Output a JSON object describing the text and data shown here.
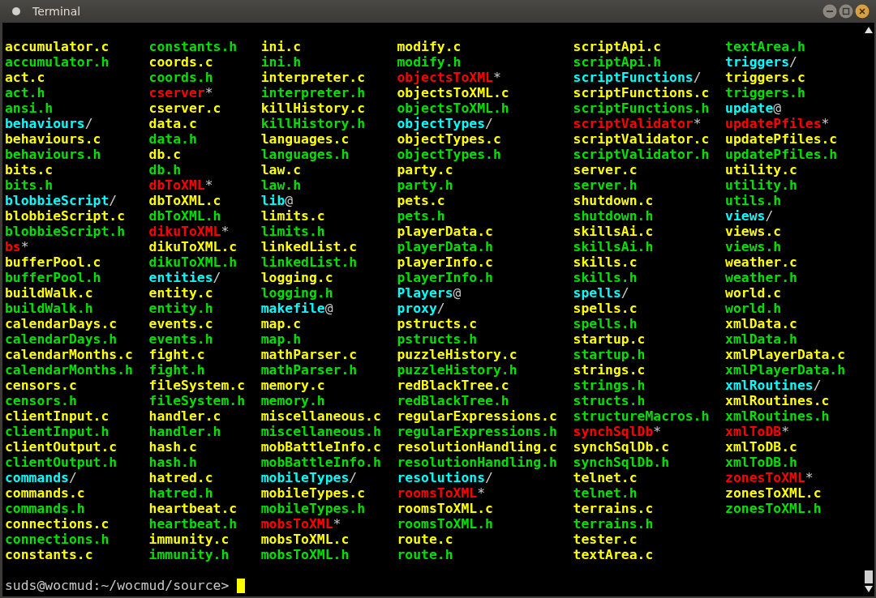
{
  "window": {
    "title": "Terminal"
  },
  "listing": {
    "columns": [
      [
        {
          "name": "accumulator.c",
          "color": "#ffff00"
        },
        {
          "name": "accumulator.h",
          "color": "#00e000"
        },
        {
          "name": "act.c",
          "color": "#ffff00"
        },
        {
          "name": "act.h",
          "color": "#00e000"
        },
        {
          "name": "ansi.h",
          "color": "#00e000"
        },
        {
          "name": "behaviours",
          "suffix": "/",
          "color": "#00ffff"
        },
        {
          "name": "behaviours.c",
          "color": "#ffff00"
        },
        {
          "name": "behaviours.h",
          "color": "#00e000"
        },
        {
          "name": "bits.c",
          "color": "#ffff00"
        },
        {
          "name": "bits.h",
          "color": "#00e000"
        },
        {
          "name": "blobbieScript",
          "suffix": "/",
          "color": "#00ffff"
        },
        {
          "name": "blobbieScript.c",
          "color": "#ffff00"
        },
        {
          "name": "blobbieScript.h",
          "color": "#00e000"
        },
        {
          "name": "bs",
          "suffix": "*",
          "color": "#ff0000"
        },
        {
          "name": "bufferPool.c",
          "color": "#ffff00"
        },
        {
          "name": "bufferPool.h",
          "color": "#00e000"
        },
        {
          "name": "buildWalk.c",
          "color": "#ffff00"
        },
        {
          "name": "buildWalk.h",
          "color": "#00e000"
        },
        {
          "name": "calendarDays.c",
          "color": "#ffff00"
        },
        {
          "name": "calendarDays.h",
          "color": "#00e000"
        },
        {
          "name": "calendarMonths.c",
          "color": "#ffff00"
        },
        {
          "name": "calendarMonths.h",
          "color": "#00e000"
        },
        {
          "name": "censors.c",
          "color": "#ffff00"
        },
        {
          "name": "censors.h",
          "color": "#00e000"
        },
        {
          "name": "clientInput.c",
          "color": "#ffff00"
        },
        {
          "name": "clientInput.h",
          "color": "#00e000"
        },
        {
          "name": "clientOutput.c",
          "color": "#ffff00"
        },
        {
          "name": "clientOutput.h",
          "color": "#00e000"
        },
        {
          "name": "commands",
          "suffix": "/",
          "color": "#00ffff"
        },
        {
          "name": "commands.c",
          "color": "#ffff00"
        },
        {
          "name": "commands.h",
          "color": "#00e000"
        },
        {
          "name": "connections.c",
          "color": "#ffff00"
        },
        {
          "name": "connections.h",
          "color": "#00e000"
        },
        {
          "name": "constants.c",
          "color": "#ffff00"
        }
      ],
      [
        {
          "name": "constants.h",
          "color": "#00e000"
        },
        {
          "name": "coords.c",
          "color": "#ffff00"
        },
        {
          "name": "coords.h",
          "color": "#00e000"
        },
        {
          "name": "cserver",
          "suffix": "*",
          "color": "#ff0000"
        },
        {
          "name": "cserver.c",
          "color": "#ffff00"
        },
        {
          "name": "data.c",
          "color": "#ffff00"
        },
        {
          "name": "data.h",
          "color": "#00e000"
        },
        {
          "name": "db.c",
          "color": "#ffff00"
        },
        {
          "name": "db.h",
          "color": "#00e000"
        },
        {
          "name": "dbToXML",
          "suffix": "*",
          "color": "#ff0000"
        },
        {
          "name": "dbToXML.c",
          "color": "#ffff00"
        },
        {
          "name": "dbToXML.h",
          "color": "#00e000"
        },
        {
          "name": "dikuToXML",
          "suffix": "*",
          "color": "#ff0000"
        },
        {
          "name": "dikuToXML.c",
          "color": "#ffff00"
        },
        {
          "name": "dikuToXML.h",
          "color": "#00e000"
        },
        {
          "name": "entities",
          "suffix": "/",
          "color": "#00ffff"
        },
        {
          "name": "entity.c",
          "color": "#ffff00"
        },
        {
          "name": "entity.h",
          "color": "#00e000"
        },
        {
          "name": "events.c",
          "color": "#ffff00"
        },
        {
          "name": "events.h",
          "color": "#00e000"
        },
        {
          "name": "fight.c",
          "color": "#ffff00"
        },
        {
          "name": "fight.h",
          "color": "#00e000"
        },
        {
          "name": "fileSystem.c",
          "color": "#ffff00"
        },
        {
          "name": "fileSystem.h",
          "color": "#00e000"
        },
        {
          "name": "handler.c",
          "color": "#ffff00"
        },
        {
          "name": "handler.h",
          "color": "#00e000"
        },
        {
          "name": "hash.c",
          "color": "#ffff00"
        },
        {
          "name": "hash.h",
          "color": "#00e000"
        },
        {
          "name": "hatred.c",
          "color": "#ffff00"
        },
        {
          "name": "hatred.h",
          "color": "#00e000"
        },
        {
          "name": "heartbeat.c",
          "color": "#ffff00"
        },
        {
          "name": "heartbeat.h",
          "color": "#00e000"
        },
        {
          "name": "immunity.c",
          "color": "#ffff00"
        },
        {
          "name": "immunity.h",
          "color": "#00e000"
        }
      ],
      [
        {
          "name": "ini.c",
          "color": "#ffff00"
        },
        {
          "name": "ini.h",
          "color": "#00e000"
        },
        {
          "name": "interpreter.c",
          "color": "#ffff00"
        },
        {
          "name": "interpreter.h",
          "color": "#00e000"
        },
        {
          "name": "killHistory.c",
          "color": "#ffff00"
        },
        {
          "name": "killHistory.h",
          "color": "#00e000"
        },
        {
          "name": "languages.c",
          "color": "#ffff00"
        },
        {
          "name": "languages.h",
          "color": "#00e000"
        },
        {
          "name": "law.c",
          "color": "#ffff00"
        },
        {
          "name": "law.h",
          "color": "#00e000"
        },
        {
          "name": "lib",
          "suffix": "@",
          "color": "#00ffff"
        },
        {
          "name": "limits.c",
          "color": "#ffff00"
        },
        {
          "name": "limits.h",
          "color": "#00e000"
        },
        {
          "name": "linkedList.c",
          "color": "#ffff00"
        },
        {
          "name": "linkedList.h",
          "color": "#00e000"
        },
        {
          "name": "logging.c",
          "color": "#ffff00"
        },
        {
          "name": "logging.h",
          "color": "#00e000"
        },
        {
          "name": "makefile",
          "suffix": "@",
          "color": "#00ffff"
        },
        {
          "name": "map.c",
          "color": "#ffff00"
        },
        {
          "name": "map.h",
          "color": "#00e000"
        },
        {
          "name": "mathParser.c",
          "color": "#ffff00"
        },
        {
          "name": "mathParser.h",
          "color": "#00e000"
        },
        {
          "name": "memory.c",
          "color": "#ffff00"
        },
        {
          "name": "memory.h",
          "color": "#00e000"
        },
        {
          "name": "miscellaneous.c",
          "color": "#ffff00"
        },
        {
          "name": "miscellaneous.h",
          "color": "#00e000"
        },
        {
          "name": "mobBattleInfo.c",
          "color": "#ffff00"
        },
        {
          "name": "mobBattleInfo.h",
          "color": "#00e000"
        },
        {
          "name": "mobileTypes",
          "suffix": "/",
          "color": "#00ffff"
        },
        {
          "name": "mobileTypes.c",
          "color": "#ffff00"
        },
        {
          "name": "mobileTypes.h",
          "color": "#00e000"
        },
        {
          "name": "mobsToXML",
          "suffix": "*",
          "color": "#ff0000"
        },
        {
          "name": "mobsToXML.c",
          "color": "#ffff00"
        },
        {
          "name": "mobsToXML.h",
          "color": "#00e000"
        }
      ],
      [
        {
          "name": "modify.c",
          "color": "#ffff00"
        },
        {
          "name": "modify.h",
          "color": "#00e000"
        },
        {
          "name": "objectsToXML",
          "suffix": "*",
          "color": "#ff0000"
        },
        {
          "name": "objectsToXML.c",
          "color": "#ffff00"
        },
        {
          "name": "objectsToXML.h",
          "color": "#00e000"
        },
        {
          "name": "objectTypes",
          "suffix": "/",
          "color": "#00ffff"
        },
        {
          "name": "objectTypes.c",
          "color": "#ffff00"
        },
        {
          "name": "objectTypes.h",
          "color": "#00e000"
        },
        {
          "name": "party.c",
          "color": "#ffff00"
        },
        {
          "name": "party.h",
          "color": "#00e000"
        },
        {
          "name": "pets.c",
          "color": "#ffff00"
        },
        {
          "name": "pets.h",
          "color": "#00e000"
        },
        {
          "name": "playerData.c",
          "color": "#ffff00"
        },
        {
          "name": "playerData.h",
          "color": "#00e000"
        },
        {
          "name": "playerInfo.c",
          "color": "#ffff00"
        },
        {
          "name": "playerInfo.h",
          "color": "#00e000"
        },
        {
          "name": "Players",
          "suffix": "@",
          "color": "#00ffff"
        },
        {
          "name": "proxy",
          "suffix": "/",
          "color": "#00ffff"
        },
        {
          "name": "pstructs.c",
          "color": "#ffff00"
        },
        {
          "name": "pstructs.h",
          "color": "#00e000"
        },
        {
          "name": "puzzleHistory.c",
          "color": "#ffff00"
        },
        {
          "name": "puzzleHistory.h",
          "color": "#00e000"
        },
        {
          "name": "redBlackTree.c",
          "color": "#ffff00"
        },
        {
          "name": "redBlackTree.h",
          "color": "#00e000"
        },
        {
          "name": "regularExpressions.c",
          "color": "#ffff00"
        },
        {
          "name": "regularExpressions.h",
          "color": "#00e000"
        },
        {
          "name": "resolutionHandling.c",
          "color": "#ffff00"
        },
        {
          "name": "resolutionHandling.h",
          "color": "#00e000"
        },
        {
          "name": "resolutions",
          "suffix": "/",
          "color": "#00ffff"
        },
        {
          "name": "roomsToXML",
          "suffix": "*",
          "color": "#ff0000"
        },
        {
          "name": "roomsToXML.c",
          "color": "#ffff00"
        },
        {
          "name": "roomsToXML.h",
          "color": "#00e000"
        },
        {
          "name": "route.c",
          "color": "#ffff00"
        },
        {
          "name": "route.h",
          "color": "#00e000"
        }
      ],
      [
        {
          "name": "scriptApi.c",
          "color": "#ffff00"
        },
        {
          "name": "scriptApi.h",
          "color": "#00e000"
        },
        {
          "name": "scriptFunctions",
          "suffix": "/",
          "color": "#00ffff"
        },
        {
          "name": "scriptFunctions.c",
          "color": "#ffff00"
        },
        {
          "name": "scriptFunctions.h",
          "color": "#00e000"
        },
        {
          "name": "scriptValidator",
          "suffix": "*",
          "color": "#ff0000"
        },
        {
          "name": "scriptValidator.c",
          "color": "#ffff00"
        },
        {
          "name": "scriptValidator.h",
          "color": "#00e000"
        },
        {
          "name": "server.c",
          "color": "#ffff00"
        },
        {
          "name": "server.h",
          "color": "#00e000"
        },
        {
          "name": "shutdown.c",
          "color": "#ffff00"
        },
        {
          "name": "shutdown.h",
          "color": "#00e000"
        },
        {
          "name": "skillsAi.c",
          "color": "#ffff00"
        },
        {
          "name": "skillsAi.h",
          "color": "#00e000"
        },
        {
          "name": "skills.c",
          "color": "#ffff00"
        },
        {
          "name": "skills.h",
          "color": "#00e000"
        },
        {
          "name": "spells",
          "suffix": "/",
          "color": "#00ffff"
        },
        {
          "name": "spells.c",
          "color": "#ffff00"
        },
        {
          "name": "spells.h",
          "color": "#00e000"
        },
        {
          "name": "startup.c",
          "color": "#ffff00"
        },
        {
          "name": "startup.h",
          "color": "#00e000"
        },
        {
          "name": "strings.c",
          "color": "#ffff00"
        },
        {
          "name": "strings.h",
          "color": "#00e000"
        },
        {
          "name": "structs.h",
          "color": "#00e000"
        },
        {
          "name": "structureMacros.h",
          "color": "#00e000"
        },
        {
          "name": "synchSqlDb",
          "suffix": "*",
          "color": "#ff0000"
        },
        {
          "name": "synchSqlDb.c",
          "color": "#ffff00"
        },
        {
          "name": "synchSqlDb.h",
          "color": "#00e000"
        },
        {
          "name": "telnet.c",
          "color": "#ffff00"
        },
        {
          "name": "telnet.h",
          "color": "#00e000"
        },
        {
          "name": "terrains.c",
          "color": "#ffff00"
        },
        {
          "name": "terrains.h",
          "color": "#00e000"
        },
        {
          "name": "tester.c",
          "color": "#ffff00"
        },
        {
          "name": "textArea.c",
          "color": "#ffff00"
        }
      ],
      [
        {
          "name": "textArea.h",
          "color": "#00e000"
        },
        {
          "name": "triggers",
          "suffix": "/",
          "color": "#00ffff"
        },
        {
          "name": "triggers.c",
          "color": "#ffff00"
        },
        {
          "name": "triggers.h",
          "color": "#00e000"
        },
        {
          "name": "update",
          "suffix": "@",
          "color": "#00ffff"
        },
        {
          "name": "updatePfiles",
          "suffix": "*",
          "color": "#ff0000"
        },
        {
          "name": "updatePfiles.c",
          "color": "#ffff00"
        },
        {
          "name": "updatePfiles.h",
          "color": "#00e000"
        },
        {
          "name": "utility.c",
          "color": "#ffff00"
        },
        {
          "name": "utility.h",
          "color": "#00e000"
        },
        {
          "name": "utils.h",
          "color": "#00e000"
        },
        {
          "name": "views",
          "suffix": "/",
          "color": "#00ffff"
        },
        {
          "name": "views.c",
          "color": "#ffff00"
        },
        {
          "name": "views.h",
          "color": "#00e000"
        },
        {
          "name": "weather.c",
          "color": "#ffff00"
        },
        {
          "name": "weather.h",
          "color": "#00e000"
        },
        {
          "name": "world.c",
          "color": "#ffff00"
        },
        {
          "name": "world.h",
          "color": "#00e000"
        },
        {
          "name": "xmlData.c",
          "color": "#ffff00"
        },
        {
          "name": "xmlData.h",
          "color": "#00e000"
        },
        {
          "name": "xmlPlayerData.c",
          "color": "#ffff00"
        },
        {
          "name": "xmlPlayerData.h",
          "color": "#00e000"
        },
        {
          "name": "xmlRoutines",
          "suffix": "/",
          "color": "#00ffff"
        },
        {
          "name": "xmlRoutines.c",
          "color": "#ffff00"
        },
        {
          "name": "xmlRoutines.h",
          "color": "#00e000"
        },
        {
          "name": "xmlToDB",
          "suffix": "*",
          "color": "#ff0000"
        },
        {
          "name": "xmlToDB.c",
          "color": "#ffff00"
        },
        {
          "name": "xmlToDB.h",
          "color": "#00e000"
        },
        {
          "name": "zonesToXML",
          "suffix": "*",
          "color": "#ff0000"
        },
        {
          "name": "zonesToXML.c",
          "color": "#ffff00"
        },
        {
          "name": "zonesToXML.h",
          "color": "#00e000"
        }
      ]
    ]
  },
  "prompt": {
    "text": "suds@wocmud:~/wocmud/source>"
  }
}
